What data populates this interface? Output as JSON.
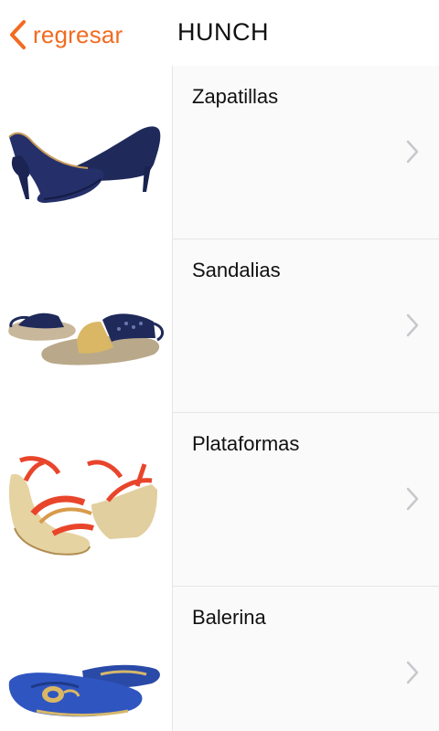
{
  "header": {
    "back_label": "regresar",
    "title": "HUNCH"
  },
  "accent_color": "#f26b21",
  "categories": [
    {
      "label": "Zapatillas",
      "image": "navy-pump-heels"
    },
    {
      "label": "Sandalias",
      "image": "navy-gold-flat-sandals"
    },
    {
      "label": "Plataformas",
      "image": "red-wedge-sandals"
    },
    {
      "label": "Balerina",
      "image": "blue-ballerina-flats"
    }
  ],
  "icons": {
    "back": "chevron-left-icon",
    "row": "chevron-right-icon"
  }
}
